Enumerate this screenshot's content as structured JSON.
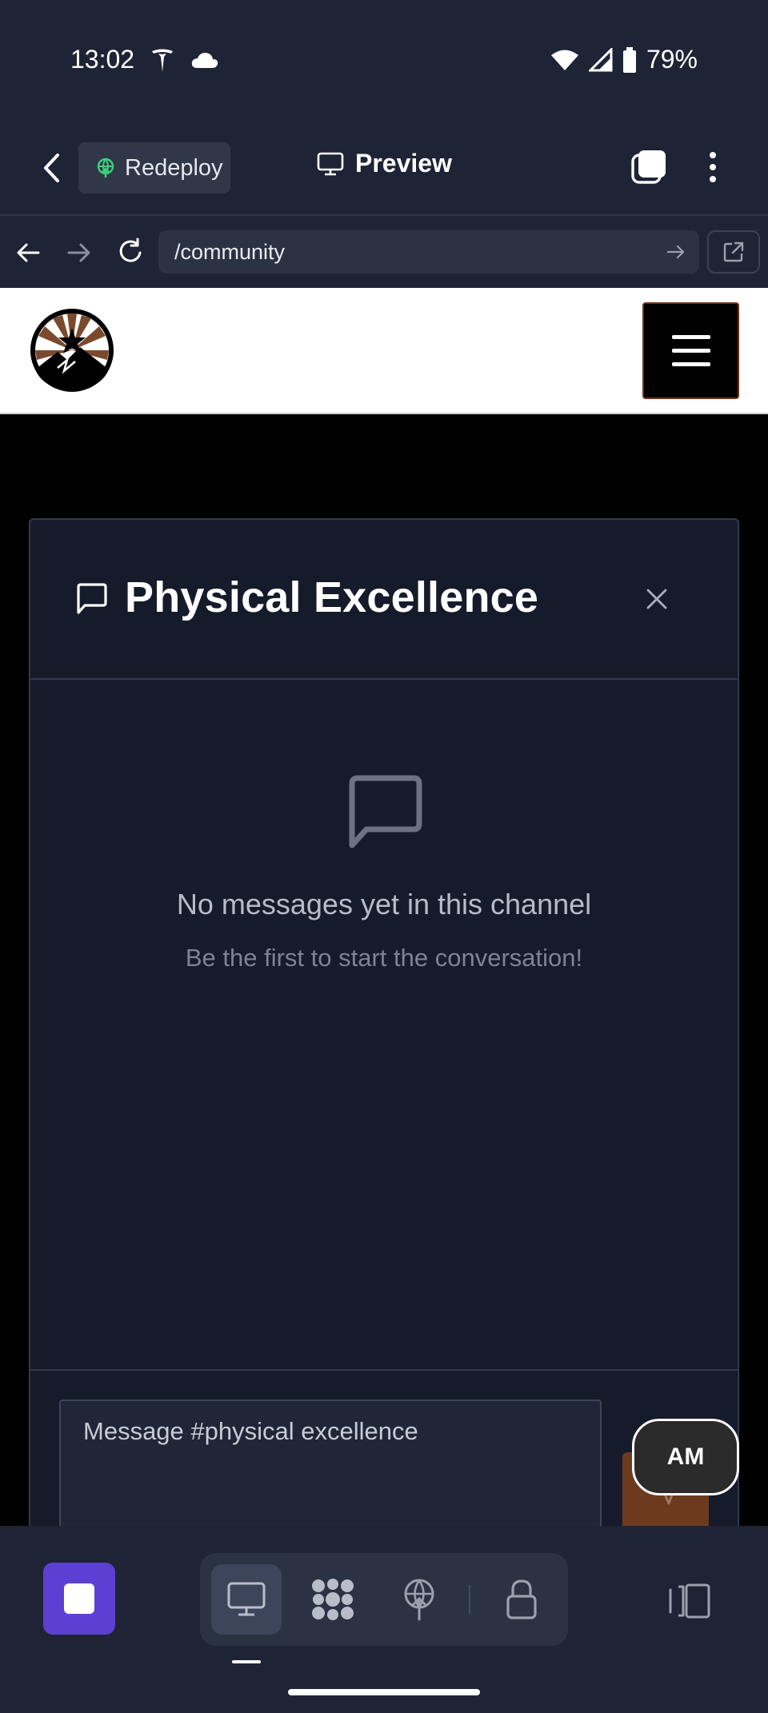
{
  "status_bar": {
    "time": "13:02",
    "battery": "79%",
    "icons": [
      "tesla-icon",
      "cloud-icon",
      "wifi-icon",
      "signal-icon",
      "battery-icon"
    ]
  },
  "toolbar": {
    "redeploy_label": "Redeploy",
    "preview_label": "Preview"
  },
  "url_bar": {
    "url": "/community"
  },
  "channel": {
    "title": "Physical Excellence",
    "empty_title": "No messages yet in this channel",
    "empty_subtitle": "Be the first to start the conversation!",
    "input_placeholder": "Message #physical excellence"
  },
  "avatar": {
    "initials": "AM"
  },
  "colors": {
    "app_bg": "#1e2435",
    "panel_bg": "#151b2a",
    "accent_purple": "#5d3fd3",
    "send_button": "#6d3a20"
  }
}
